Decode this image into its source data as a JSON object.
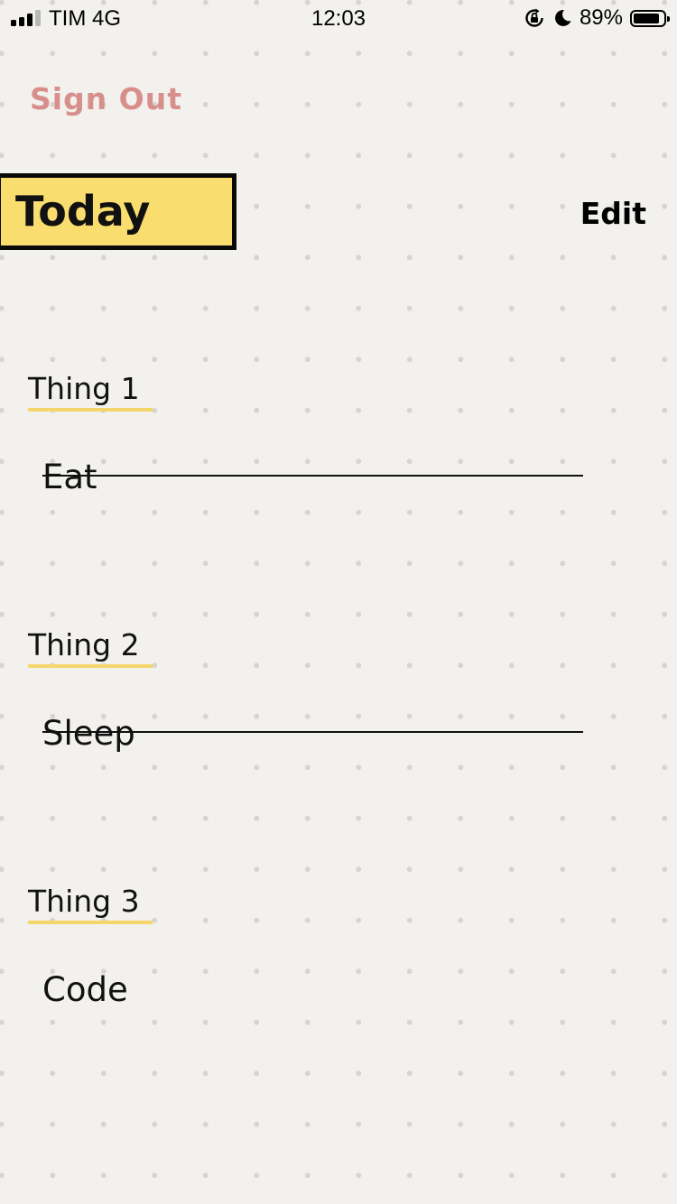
{
  "status_bar": {
    "carrier": "TIM 4G",
    "time": "12:03",
    "battery_percent": "89%",
    "battery_level": 0.89,
    "icons": [
      "signal-icon",
      "orientation-lock-icon",
      "moon-icon",
      "battery-icon"
    ]
  },
  "header": {
    "sign_out_label": "Sign Out",
    "title": "Today",
    "edit_label": "Edit"
  },
  "colors": {
    "background": "#f2f1ed",
    "title_highlight": "#f9dd6f",
    "label_underline": "#f5d66b",
    "sign_out": "#d88f8b"
  },
  "things": [
    {
      "label": "Thing 1",
      "value": "Eat",
      "completed": true
    },
    {
      "label": "Thing 2",
      "value": "Sleep",
      "completed": true
    },
    {
      "label": "Thing 3",
      "value": "Code",
      "completed": false
    }
  ]
}
